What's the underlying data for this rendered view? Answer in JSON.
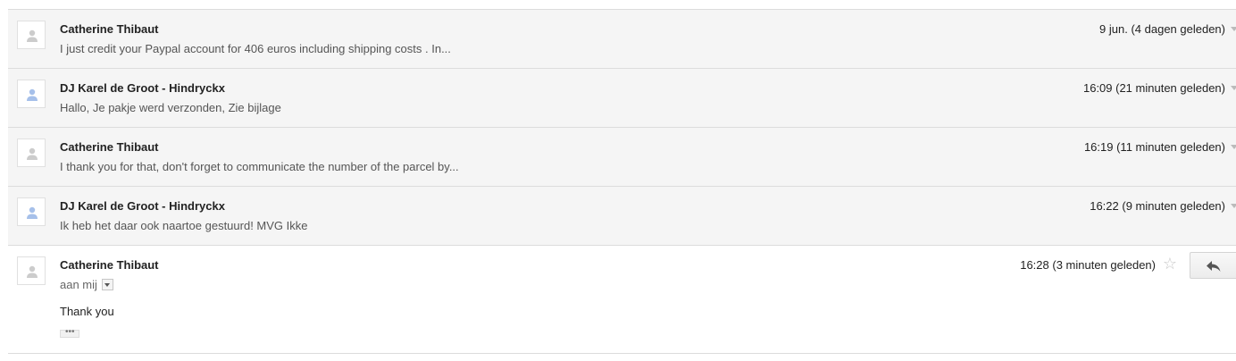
{
  "thread": {
    "messages": [
      {
        "sender": "Catherine Thibaut",
        "snippet": "I just credit your Paypal account for 406 euros including shipping costs . In...",
        "date": "9 jun. (4 dagen geleden)",
        "avatar_color": "#cccccc"
      },
      {
        "sender": "DJ Karel de Groot - Hindryckx",
        "snippet": "Hallo, Je pakje werd verzonden, Zie bijlage",
        "date": "16:09 (21 minuten geleden)",
        "avatar_color": "#a6c0ea"
      },
      {
        "sender": "Catherine Thibaut",
        "snippet": "I thank you for that, don't forget to communicate the number of the parcel by...",
        "date": "16:19 (11 minuten geleden)",
        "avatar_color": "#cccccc"
      },
      {
        "sender": "DJ Karel de Groot - Hindryckx",
        "snippet": "Ik heb het daar ook naartoe gestuurd! MVG Ikke",
        "date": "16:22 (9 minuten geleden)",
        "avatar_color": "#a6c0ea"
      }
    ],
    "expanded": {
      "sender": "Catherine Thibaut",
      "to_line": "aan mij",
      "date": "16:28 (3 minuten geleden)",
      "body": "Thank you",
      "trimmed_label": "•••",
      "star_icon": "☆",
      "reply_icon": "reply-arrow-icon",
      "avatar_color": "#cccccc"
    }
  }
}
